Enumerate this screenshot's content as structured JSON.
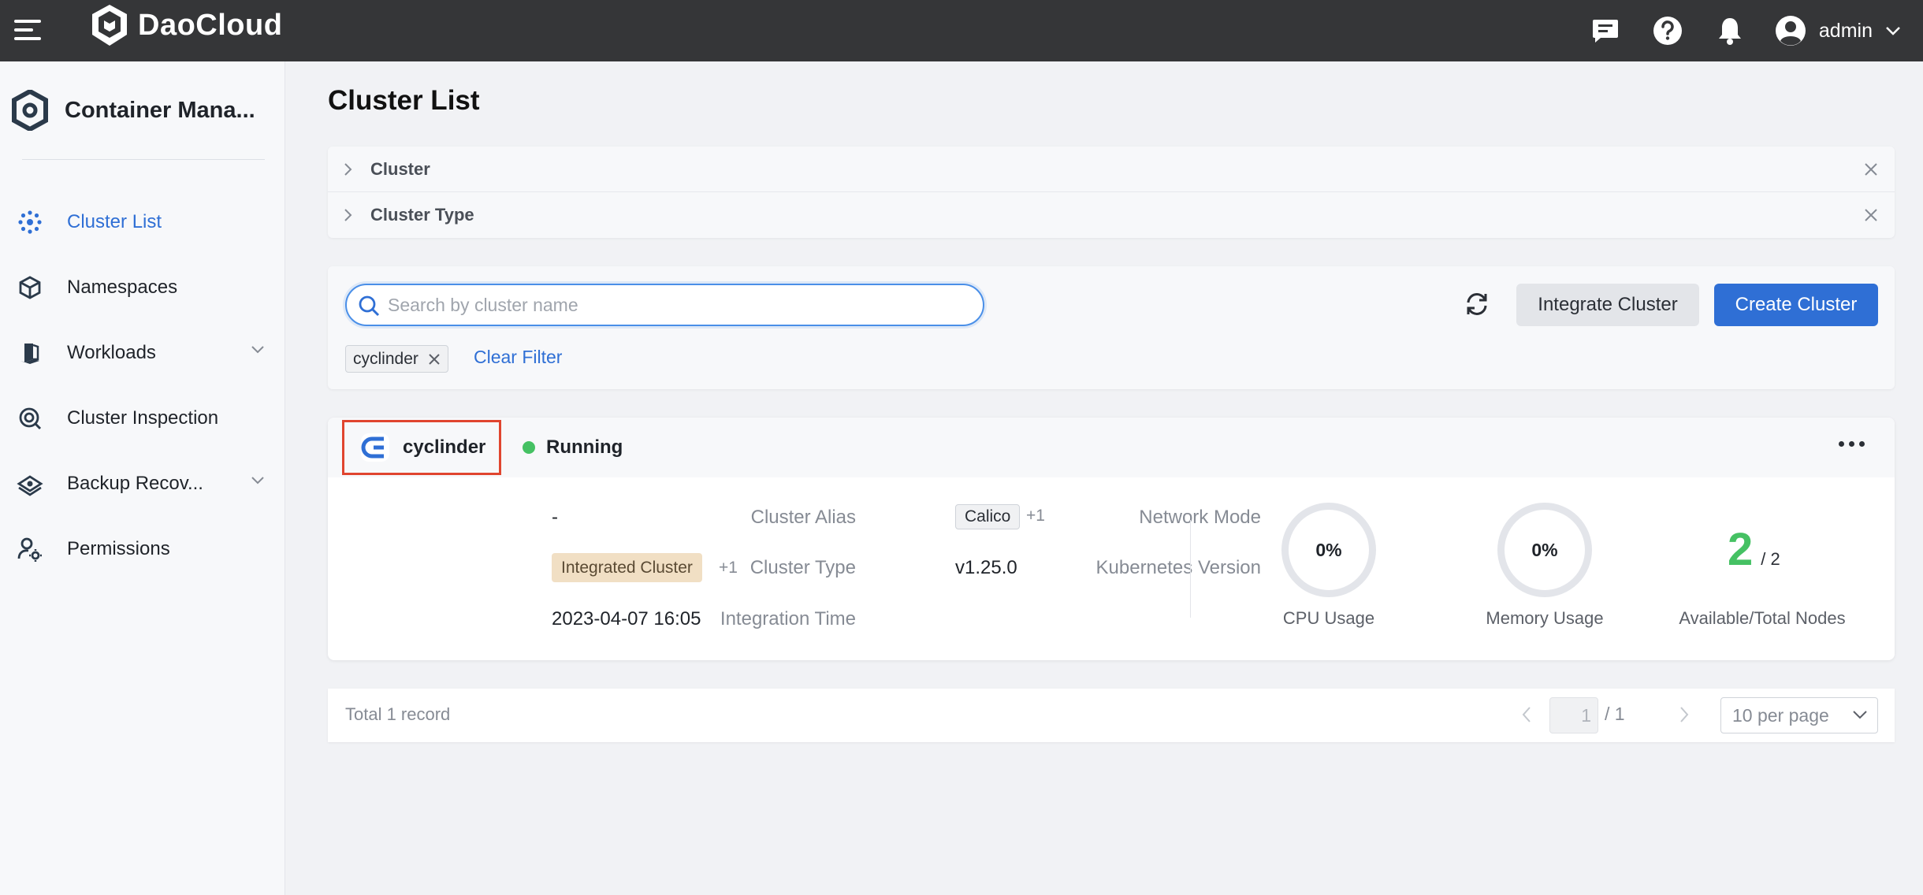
{
  "header": {
    "brand": "DaoCloud",
    "user": "admin",
    "icons": [
      "menu-icon",
      "message-icon",
      "help-icon",
      "bell-icon",
      "user-avatar-icon",
      "chevron-down-icon"
    ]
  },
  "sidebar": {
    "product_name": "Container Mana...",
    "items": [
      {
        "label": "Cluster List",
        "icon": "cluster-icon",
        "active": true
      },
      {
        "label": "Namespaces",
        "icon": "namespace-cube-icon"
      },
      {
        "label": "Workloads",
        "icon": "workload-icon",
        "expandable": true
      },
      {
        "label": "Cluster Inspection",
        "icon": "inspection-icon"
      },
      {
        "label": "Backup Recov...",
        "icon": "backup-icon",
        "expandable": true
      },
      {
        "label": "Permissions",
        "icon": "permissions-user-gear-icon"
      }
    ]
  },
  "page": {
    "title": "Cluster List"
  },
  "filters": {
    "rows": [
      {
        "label": "Cluster"
      },
      {
        "label": "Cluster Type"
      }
    ]
  },
  "toolbar": {
    "search_placeholder": "Search by cluster name",
    "search_value": "",
    "integrate_label": "Integrate Cluster",
    "create_label": "Create Cluster",
    "active_tag": "cyclinder",
    "clear_filter_label": "Clear Filter"
  },
  "cluster": {
    "name": "cyclinder",
    "status": "Running",
    "alias_label": "Cluster Alias",
    "alias_value": "-",
    "type_label": "Cluster Type",
    "type_value": "Integrated Cluster",
    "type_more": "+1",
    "time_label": "Integration Time",
    "time_value": "2023-04-07 16:05",
    "network_label": "Network Mode",
    "network_value": "Calico",
    "network_more": "+1",
    "k8s_label": "Kubernetes Version",
    "k8s_value": "v1.25.0",
    "cpu_value": "0%",
    "cpu_label": "CPU Usage",
    "mem_value": "0%",
    "mem_label": "Memory Usage",
    "nodes_available": "2",
    "nodes_total": "/ 2",
    "nodes_label": "Available/Total Nodes"
  },
  "pagination": {
    "total_text": "Total 1 record",
    "current_page": "1",
    "page_of": "/ 1",
    "per_page": "10 per page"
  },
  "colors": {
    "topbar": "#353638",
    "accent": "#2f6fd5",
    "status_running": "#45c163",
    "highlight_border": "#e0452f",
    "type_badge": "#f1dfc4"
  }
}
